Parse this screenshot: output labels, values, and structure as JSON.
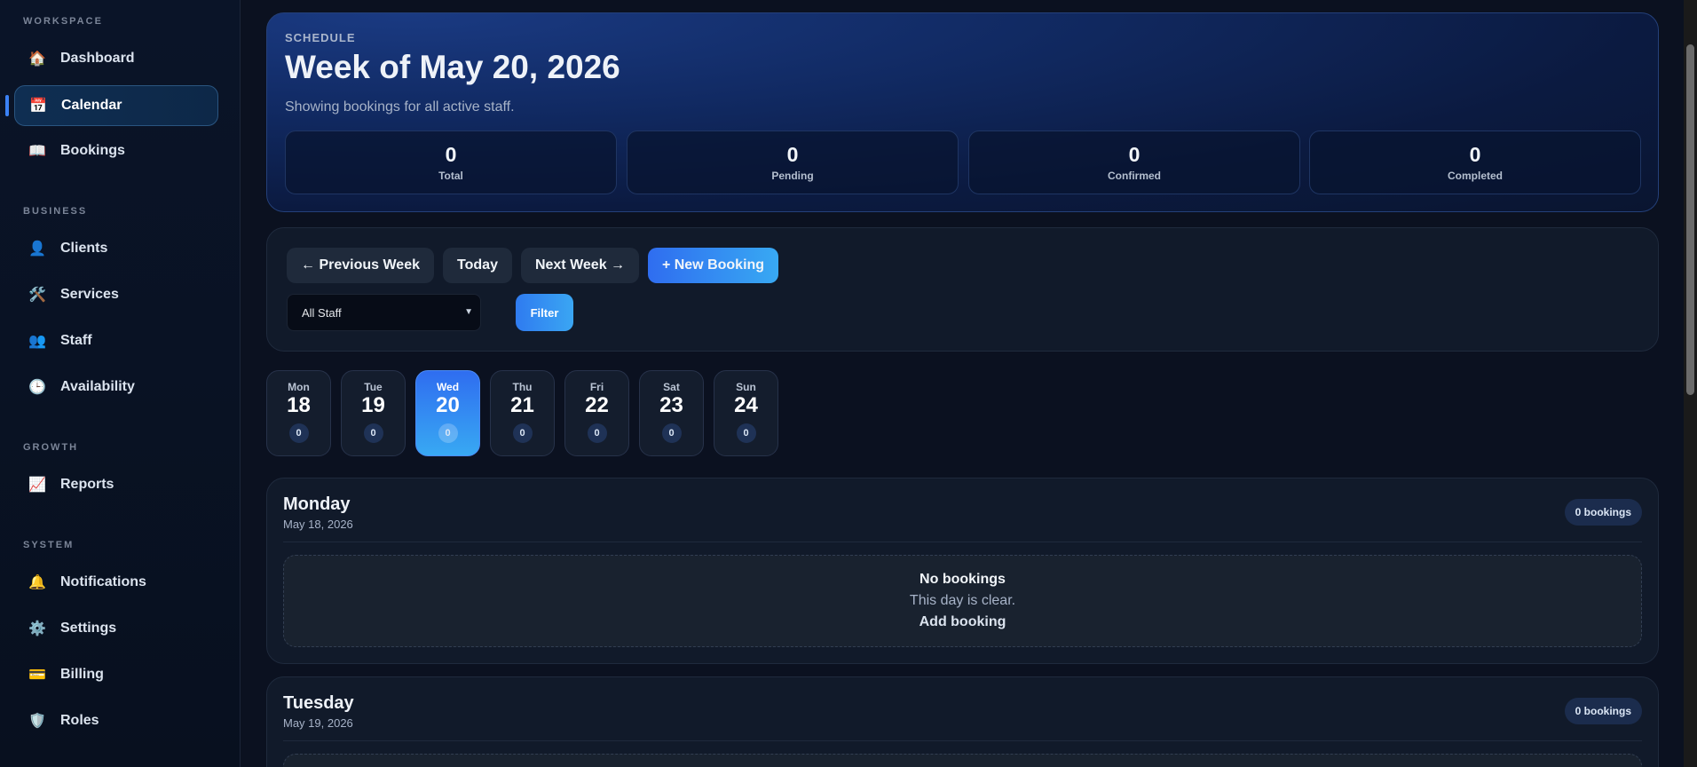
{
  "sidebar": {
    "sections": [
      {
        "label": "WORKSPACE"
      },
      {
        "label": "BUSINESS"
      },
      {
        "label": "GROWTH"
      },
      {
        "label": "SYSTEM"
      }
    ],
    "items": [
      {
        "label": "Dashboard",
        "icon": "🏠",
        "icon_name": "home-icon"
      },
      {
        "label": "Calendar",
        "icon": "📅",
        "icon_name": "calendar-icon",
        "active": true
      },
      {
        "label": "Bookings",
        "icon": "📖",
        "icon_name": "book-icon"
      },
      {
        "label": "Clients",
        "icon": "👤",
        "icon_name": "user-icon"
      },
      {
        "label": "Services",
        "icon": "🛠️",
        "icon_name": "tools-icon"
      },
      {
        "label": "Staff",
        "icon": "👥",
        "icon_name": "users-icon"
      },
      {
        "label": "Availability",
        "icon": "🕒",
        "icon_name": "clock-icon"
      },
      {
        "label": "Reports",
        "icon": "📈",
        "icon_name": "chart-icon"
      },
      {
        "label": "Notifications",
        "icon": "🔔",
        "icon_name": "bell-icon"
      },
      {
        "label": "Settings",
        "icon": "⚙️",
        "icon_name": "gear-icon"
      },
      {
        "label": "Billing",
        "icon": "💳",
        "icon_name": "card-icon"
      },
      {
        "label": "Roles",
        "icon": "🛡️",
        "icon_name": "shield-icon"
      }
    ]
  },
  "hero": {
    "kicker": "SCHEDULE",
    "title": "Week of May 20, 2026",
    "subtitle": "Showing bookings for all active staff.",
    "stats": [
      {
        "value": "0",
        "label": "Total"
      },
      {
        "value": "0",
        "label": "Pending"
      },
      {
        "value": "0",
        "label": "Confirmed"
      },
      {
        "value": "0",
        "label": "Completed"
      }
    ]
  },
  "controls": {
    "prev_label": "← Previous Week",
    "today_label": "Today",
    "next_label": "Next Week →",
    "new_booking_label": "+ New Booking",
    "staff_select_value": "All Staff",
    "filter_label": "Filter"
  },
  "week_days": [
    {
      "name": "Mon",
      "date": "18",
      "count": "0"
    },
    {
      "name": "Tue",
      "date": "19",
      "count": "0"
    },
    {
      "name": "Wed",
      "date": "20",
      "count": "0",
      "active": true
    },
    {
      "name": "Thu",
      "date": "21",
      "count": "0"
    },
    {
      "name": "Fri",
      "date": "22",
      "count": "0"
    },
    {
      "name": "Sat",
      "date": "23",
      "count": "0"
    },
    {
      "name": "Sun",
      "date": "24",
      "count": "0"
    }
  ],
  "day_sections": [
    {
      "name": "Monday",
      "date": "May 18, 2026",
      "badge": "0 bookings",
      "empty_title": "No bookings",
      "empty_text": "This day is clear.",
      "empty_link": "Add booking"
    },
    {
      "name": "Tuesday",
      "date": "May 19, 2026",
      "badge": "0 bookings"
    }
  ],
  "colors": {
    "accent": "#2f6df0",
    "accent_light": "#38a9f3",
    "background": "#0b1120"
  }
}
